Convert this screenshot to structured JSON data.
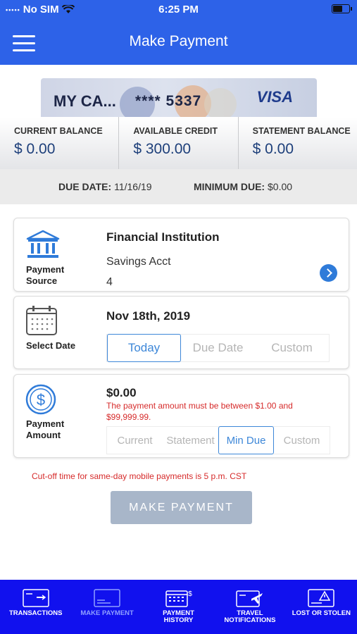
{
  "status_bar": {
    "carrier": "No SIM",
    "time": "6:25 PM",
    "battery_level": 0.6
  },
  "header": {
    "title": "Make Payment"
  },
  "card": {
    "name": "MY CA...",
    "number": "**** 5337",
    "brand": "VISA"
  },
  "balances": [
    {
      "label": "CURRENT BALANCE",
      "value": "$ 0.00"
    },
    {
      "label": "AVAILABLE CREDIT",
      "value": "$ 300.00"
    },
    {
      "label": "STATEMENT BALANCE",
      "value": "$ 0.00"
    }
  ],
  "due": {
    "date_label": "DUE DATE:",
    "date_value": "11/16/19",
    "min_label": "MINIMUM DUE:",
    "min_value": "$0.00"
  },
  "payment_source": {
    "label_line1": "Payment",
    "label_line2": "Source",
    "institution": "Financial Institution",
    "account": "Savings Acct",
    "account_suffix": "4"
  },
  "select_date": {
    "label": "Select Date",
    "date": "Nov 18th, 2019",
    "options": [
      "Today",
      "Due Date",
      "Custom"
    ],
    "selected": "Today"
  },
  "payment_amount": {
    "label_line1": "Payment",
    "label_line2": "Amount",
    "amount": "$0.00",
    "error": "The payment amount must be between $1.00 and $99,999.99.",
    "options": [
      "Current",
      "Statement",
      "Min Due",
      "Custom"
    ],
    "selected": "Min Due"
  },
  "cutoff_note": "Cut-off time for same-day mobile payments is 5 p.m. CST",
  "make_payment_button": "MAKE PAYMENT",
  "tabs": [
    {
      "label": "TRANSACTIONS",
      "icon": "transactions-card-icon"
    },
    {
      "label": "MAKE PAYMENT",
      "icon": "payment-card-icon",
      "active": true
    },
    {
      "label_line1": "PAYMENT",
      "label_line2": "HISTORY",
      "icon": "calendar-dollar-icon"
    },
    {
      "label_line1": "TRAVEL",
      "label_line2": "NOTIFICATIONS",
      "icon": "card-plane-icon"
    },
    {
      "label": "LOST OR STOLEN",
      "icon": "card-warning-icon"
    }
  ],
  "colors": {
    "header": "#2d62e8",
    "tabbar": "#1111ee",
    "accent": "#3d87d8",
    "error": "#d62b2b"
  }
}
